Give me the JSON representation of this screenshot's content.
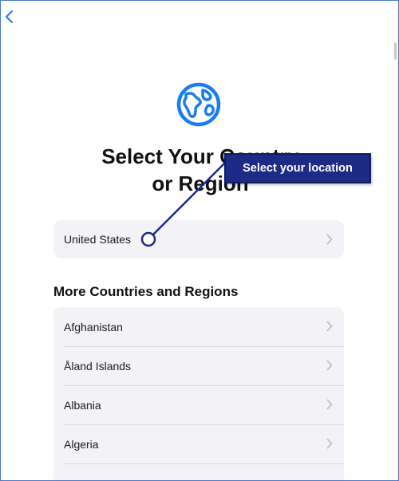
{
  "title_line1": "Select Your Country",
  "title_line2": "or Region",
  "primary_country": "United States",
  "section_heading": "More Countries and Regions",
  "countries": [
    "Afghanistan",
    "Åland Islands",
    "Albania",
    "Algeria"
  ],
  "callout_text": "Select your location",
  "colors": {
    "accent": "#1a7cf2",
    "callout": "#1d2a86",
    "row_bg": "#f2f2f7"
  },
  "icons": {
    "back": "chevron-left-icon",
    "globe": "globe-icon",
    "row": "chevron-right-icon"
  }
}
